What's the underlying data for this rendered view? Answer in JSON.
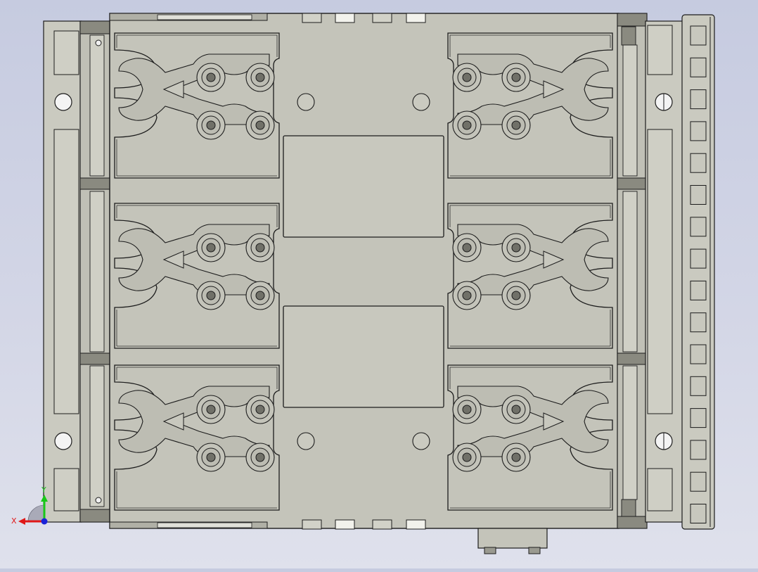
{
  "window": {
    "view": "CAD viewport"
  },
  "triad": {
    "x_label": "X",
    "y_label": "Y"
  },
  "colors": {
    "background_top": "#c6cbe0",
    "background_bottom": "#dfe1ec",
    "part_fill": "#c4c4ba",
    "part_light": "#d2d2c8",
    "edge": "#1c1c1c",
    "dark_strip": "#8a8a80",
    "axis_x": "#e01818",
    "axis_y": "#18c818",
    "axis_z": "#1a22d8"
  },
  "icons": [
    "xyz-triad-icon"
  ]
}
